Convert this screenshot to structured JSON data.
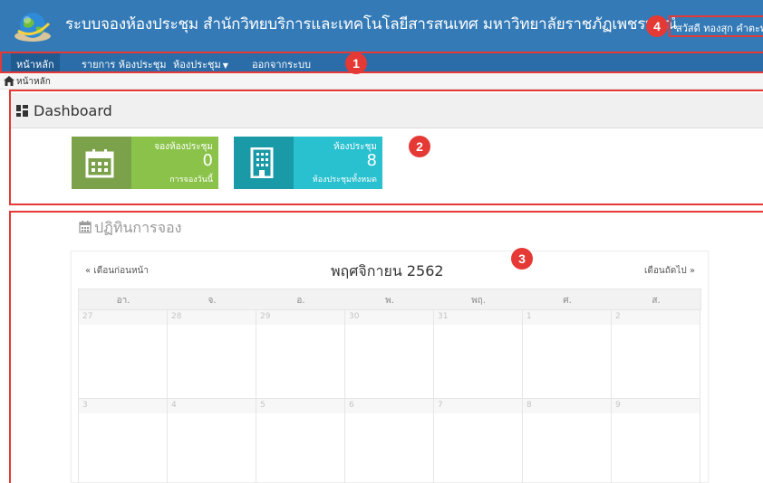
{
  "header": {
    "title": "ระบบจองห้องประชุม สำนักวิทยบริการและเทคโนโลยีสารสนเทศ มหาวิทยาลัยราชภัฏเพชรบูรณ์",
    "user_greeting": "สวัสดี ทองสุก คำตะพล"
  },
  "nav": {
    "items": [
      {
        "label": "หน้าหลัก"
      },
      {
        "label": "รายการ ห้องประชุม"
      },
      {
        "label": "ห้องประชุม"
      },
      {
        "label": "ออกจากระบบ"
      }
    ]
  },
  "breadcrumb": {
    "label": "หน้าหลัก"
  },
  "dashboard": {
    "title": "Dashboard",
    "tiles": [
      {
        "label": "จองห้องประชุม",
        "value": "0",
        "sub": "การจองวันนี้"
      },
      {
        "label": "ห้องประชุม",
        "value": "8",
        "sub": "ห้องประชุมทั้งหมด"
      }
    ]
  },
  "calendar": {
    "heading": "ปฏิทินการจอง",
    "prev": "« เดือนก่อนหน้า",
    "next": "เดือนถัดไป »",
    "month": "พฤศจิกายน 2562",
    "weekdays": [
      "อา.",
      "จ.",
      "อ.",
      "พ.",
      "พฤ.",
      "ศ.",
      "ส."
    ],
    "weeks": [
      [
        "27",
        "28",
        "29",
        "30",
        "31",
        "1",
        "2"
      ],
      [
        "3",
        "4",
        "5",
        "6",
        "7",
        "8",
        "9"
      ]
    ]
  },
  "annotations": [
    "1",
    "2",
    "3",
    "4"
  ],
  "colors": {
    "header": "#337ab7",
    "nav": "#2b6da8",
    "tile_green": "#8bc34a",
    "tile_teal": "#29c0cf",
    "annotation": "#e53935"
  }
}
